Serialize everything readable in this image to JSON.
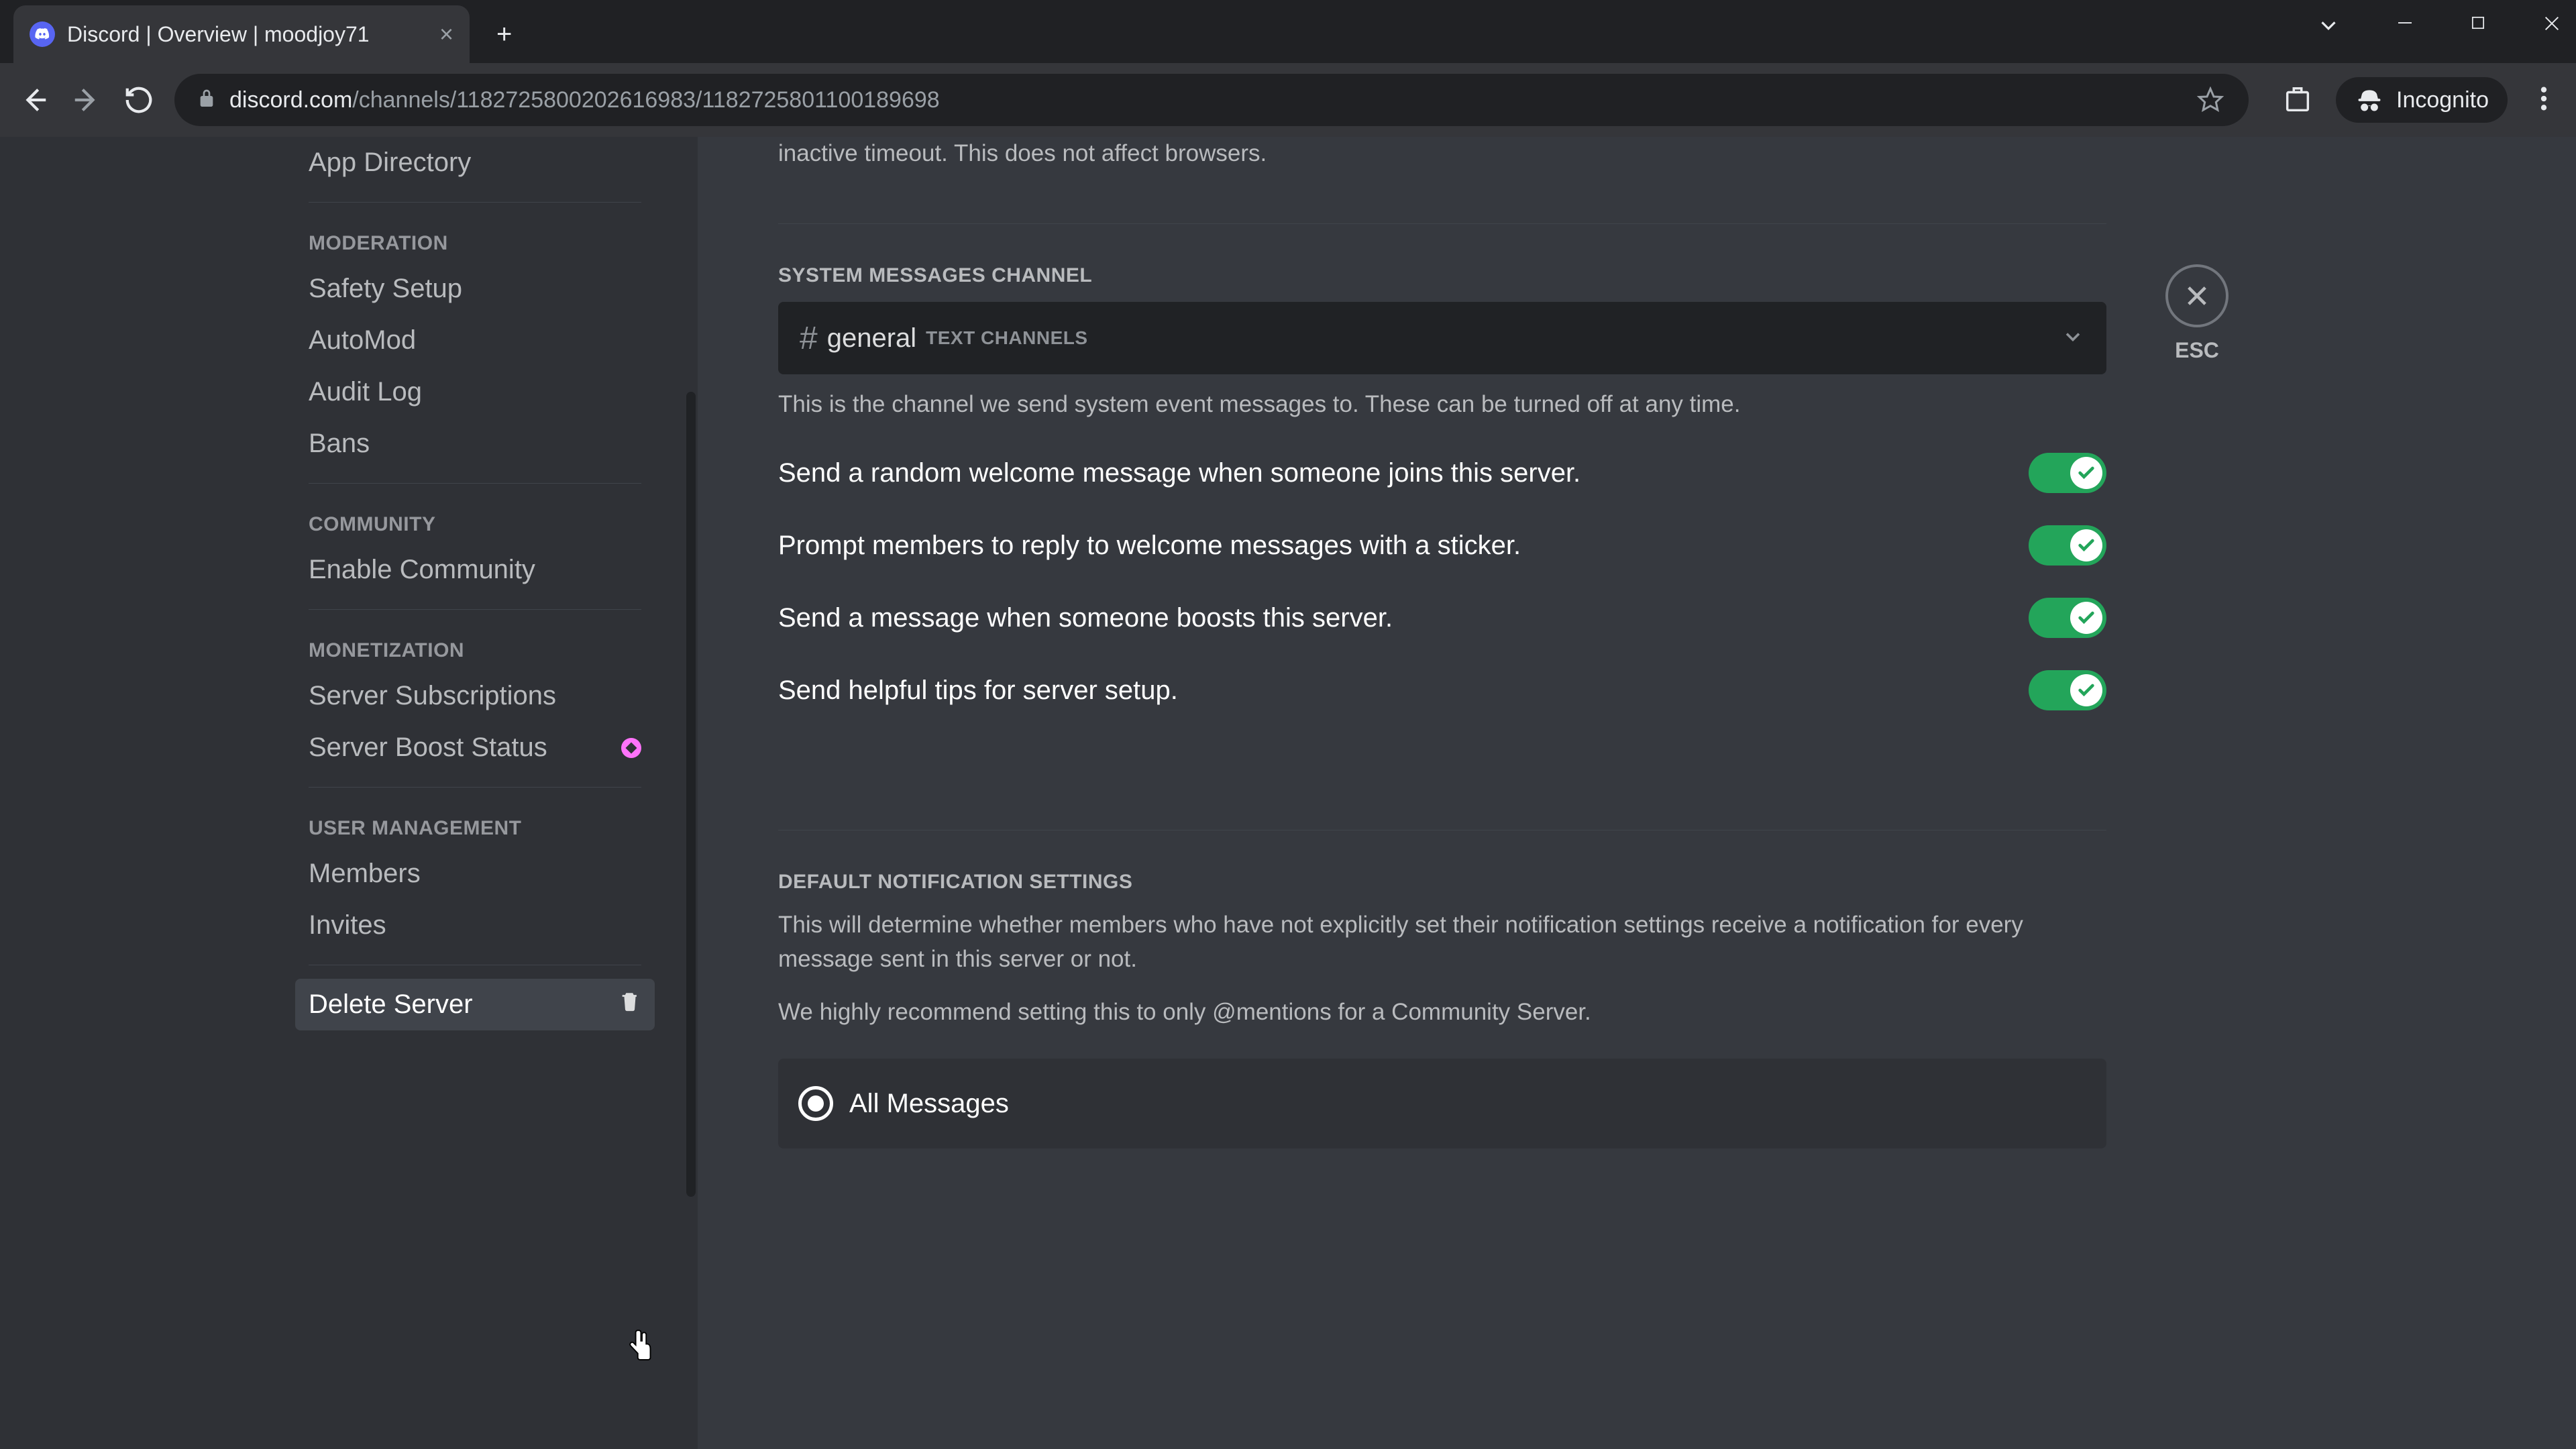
{
  "tab": {
    "title": "Discord | Overview | moodjoy71"
  },
  "browser": {
    "url_domain": "discord.com",
    "url_path": "/channels/1182725800202616983/1182725801100189698",
    "incognito_label": "Incognito"
  },
  "sidebar": {
    "item_top": "App Directory",
    "cat_moderation": "MODERATION",
    "mod_items": [
      "Safety Setup",
      "AutoMod",
      "Audit Log",
      "Bans"
    ],
    "cat_community": "COMMUNITY",
    "community_item": "Enable Community",
    "cat_monetization": "MONETIZATION",
    "monetization_items": [
      "Server Subscriptions",
      "Server Boost Status"
    ],
    "cat_user_mgmt": "USER MANAGEMENT",
    "user_mgmt_items": [
      "Members",
      "Invites"
    ],
    "delete_server": "Delete Server"
  },
  "content": {
    "inactive_help": "inactive timeout. This does not affect browsers.",
    "sys_header": "SYSTEM MESSAGES CHANNEL",
    "sys_channel": "general",
    "sys_channel_group": "TEXT CHANNELS",
    "sys_help": "This is the channel we send system event messages to. These can be turned off at any time.",
    "toggles": [
      "Send a random welcome message when someone joins this server.",
      "Prompt members to reply to welcome messages with a sticker.",
      "Send a message when someone boosts this server.",
      "Send helpful tips for server setup."
    ],
    "notif_header": "DEFAULT NOTIFICATION SETTINGS",
    "notif_help1": "This will determine whether members who have not explicitly set their notification settings receive a notification for every message sent in this server or not.",
    "notif_help2": "We highly recommend setting this to only @mentions for a Community Server.",
    "radio_all": "All Messages"
  },
  "close": {
    "label": "ESC"
  }
}
